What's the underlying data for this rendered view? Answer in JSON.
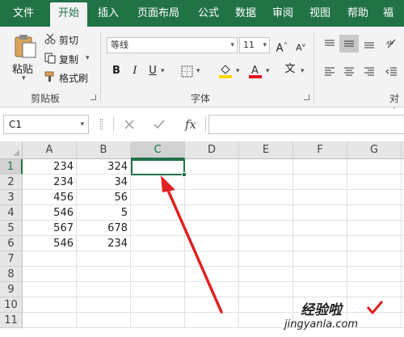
{
  "tabs": [
    "文件",
    "开始",
    "插入",
    "页面布局",
    "公式",
    "数据",
    "审阅",
    "视图",
    "帮助",
    "福"
  ],
  "ribbon": {
    "paste_label": "粘贴",
    "cut_label": "剪切",
    "copy_label": "复制",
    "format_painter_label": "格式刷",
    "clipboard_group": "剪贴板",
    "font_name": "等线",
    "font_size": "11",
    "font_group": "字体",
    "align_group": "对齐"
  },
  "formula_bar": {
    "name_box": "C1",
    "fx_label": "fx",
    "value": ""
  },
  "columns": [
    "A",
    "B",
    "C",
    "D",
    "E",
    "F",
    "G"
  ],
  "selected_column": "C",
  "rows": [
    {
      "n": "1",
      "A": "234",
      "B": "324"
    },
    {
      "n": "2",
      "A": "234",
      "B": "34"
    },
    {
      "n": "3",
      "A": "456",
      "B": "56"
    },
    {
      "n": "4",
      "A": "546",
      "B": "5"
    },
    {
      "n": "5",
      "A": "567",
      "B": "678"
    },
    {
      "n": "6",
      "A": "546",
      "B": "234"
    },
    {
      "n": "7",
      "A": "",
      "B": ""
    },
    {
      "n": "8",
      "A": "",
      "B": ""
    },
    {
      "n": "9",
      "A": "",
      "B": ""
    },
    {
      "n": "10",
      "A": "",
      "B": ""
    },
    {
      "n": "11",
      "A": "",
      "B": ""
    }
  ],
  "watermark": {
    "line1": "经验啦",
    "line2": "jingyanla.com"
  },
  "colors": {
    "accent": "#217346",
    "arrow": "#e02020"
  }
}
